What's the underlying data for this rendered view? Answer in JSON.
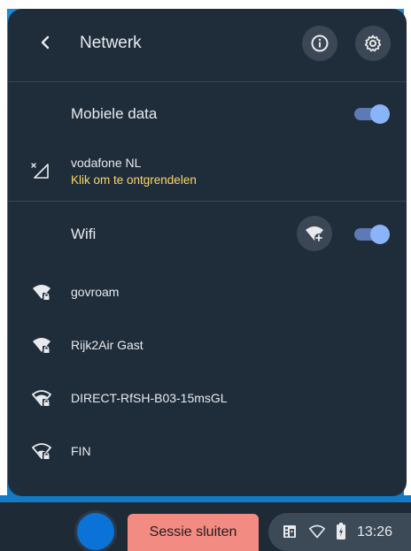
{
  "header": {
    "title": "Netwerk",
    "back_icon": "arrow-back-icon",
    "info_icon": "info-icon",
    "settings_icon": "gear-icon"
  },
  "mobile_data": {
    "label": "Mobiele data",
    "enabled": true,
    "carrier": "vodafone NL",
    "status": "Klik om te ontgrendelen",
    "status_color": "#fdd663"
  },
  "wifi": {
    "label": "Wifi",
    "enabled": true,
    "add_network_icon": "wifi-add-icon",
    "networks": [
      {
        "name": "govroam",
        "icon": "wifi-locked-icon"
      },
      {
        "name": "Rijk2Air Gast",
        "icon": "wifi-locked-icon"
      },
      {
        "name": "DIRECT-RfSH-B03-15msGL",
        "icon": "wifi-locked-icon"
      },
      {
        "name": "FIN",
        "icon": "wifi-locked-icon"
      }
    ]
  },
  "shelf": {
    "session_button": "Sessie sluiten",
    "time": "13:26"
  },
  "colors": {
    "panel_bg": "#1f2d3b",
    "accent": "#8ab4f8",
    "warning_text": "#fdd663",
    "session_button_bg": "#f28b82"
  }
}
